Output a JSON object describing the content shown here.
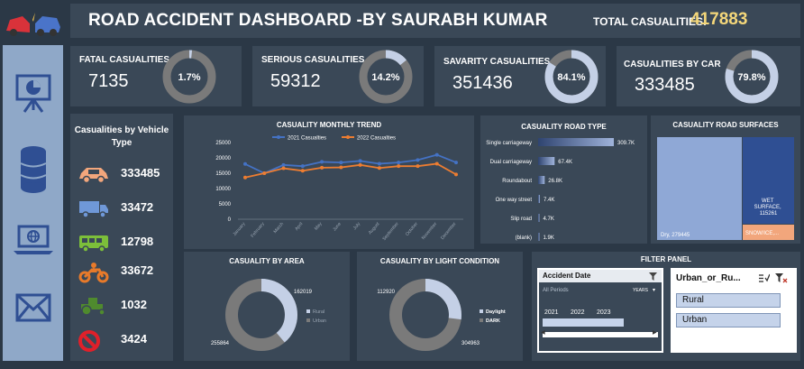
{
  "header": {
    "title": "ROAD ACCIDENT DASHBOARD -BY SAURABH KUMAR",
    "total_label": "TOTAL CASUALITIES:",
    "total_value": "417883"
  },
  "rail_icons": [
    "car-crash-icon",
    "presentation-chart-icon",
    "database-icon",
    "laptop-globe-icon",
    "mail-icon"
  ],
  "kpis": [
    {
      "label": "FATAL CASUALITIES",
      "value": "7135",
      "pct": "1.7%",
      "fraction": 0.017
    },
    {
      "label": "SERIOUS CASUALITIES",
      "value": "59312",
      "pct": "14.2%",
      "fraction": 0.142
    },
    {
      "label": "SAVARITY CASUALITIES",
      "value": "351436",
      "pct": "84.1%",
      "fraction": 0.841
    },
    {
      "label": "CASUALITIES BY CAR",
      "value": "333485",
      "pct": "79.8%",
      "fraction": 0.798
    }
  ],
  "vehicle": {
    "title": "Casualities by Vehicle Type",
    "items": [
      {
        "icon": "car-icon",
        "value": "333485",
        "color": "#f2a67c"
      },
      {
        "icon": "truck-icon",
        "value": "33472",
        "color": "#6f98d8"
      },
      {
        "icon": "bus-icon",
        "value": "12798",
        "color": "#7cbf3a"
      },
      {
        "icon": "motorcycle-icon",
        "value": "33672",
        "color": "#e87a2a"
      },
      {
        "icon": "tractor-icon",
        "value": "1032",
        "color": "#4f8a2e"
      },
      {
        "icon": "prohibited-icon",
        "value": "3424",
        "color": "#e0202a"
      }
    ]
  },
  "colors": {
    "series_2021": "#4472c4",
    "series_2022": "#ed7d31",
    "ring_bg": "#7a7a7a",
    "ring_fg": "#c4d0e6"
  },
  "chart_data": [
    {
      "type": "line",
      "title": "CASUALITY MONTHLY TREND",
      "categories": [
        "January",
        "February",
        "March",
        "April",
        "May",
        "June",
        "July",
        "August",
        "September",
        "October",
        "November",
        "December"
      ],
      "ylim": [
        0,
        25000
      ],
      "yticks": [
        "0",
        "5000",
        "10000",
        "15000",
        "20000",
        "25000"
      ],
      "series": [
        {
          "name": "2021 Casualties",
          "values": [
            18000,
            15000,
            17700,
            17300,
            18700,
            18500,
            19000,
            18100,
            18500,
            19300,
            21000,
            18500
          ]
        },
        {
          "name": "2022 Casualties",
          "values": [
            13600,
            15000,
            16600,
            15800,
            16800,
            16900,
            17700,
            16700,
            17300,
            17300,
            18100,
            14600
          ]
        }
      ]
    },
    {
      "type": "bar",
      "title": "CASUALITY ROAD TYPE",
      "categories": [
        "Single carriageway",
        "Dual carriageway",
        "Roundabout",
        "One way street",
        "Slip road",
        "(blank)"
      ],
      "values": [
        309.7,
        67.4,
        26.8,
        7.4,
        4.7,
        1.9
      ],
      "labels": [
        "309.7K",
        "67.4K",
        "26.8K",
        "7.4K",
        "4.7K",
        "1.9K"
      ]
    },
    {
      "type": "treemap",
      "title": "CASUALITY ROAD SURFACES",
      "items": [
        {
          "label": "Dry, 279445",
          "value": 279445,
          "color": "#8fa8d6"
        },
        {
          "label": "WET SURFACE, 115261",
          "value": 115261,
          "color": "#2f4f93"
        },
        {
          "label": "SNOW/ICE,...",
          "value": 23177,
          "color": "#f2a67c"
        }
      ]
    },
    {
      "type": "pie",
      "title": "CASUALITY BY AREA",
      "values": [
        162019,
        255864
      ],
      "labels": [
        "162019",
        "255864"
      ],
      "legend": [
        "Rural",
        "Urban"
      ]
    },
    {
      "type": "pie",
      "title": "CASUALITY BY LIGHT CONDITION",
      "values": [
        112920,
        304963
      ],
      "labels": [
        "112920",
        "304963"
      ],
      "legend": [
        "Daylight",
        "DARK"
      ]
    }
  ],
  "filter": {
    "title": "FILTER PANEL",
    "date_title": "Accident Date",
    "all_periods": "All Periods",
    "years_label": "YEARS",
    "years": [
      "2021",
      "2022",
      "2023"
    ],
    "area_title": "Urban_or_Ru...",
    "area_options": [
      "Rural",
      "Urban"
    ]
  }
}
